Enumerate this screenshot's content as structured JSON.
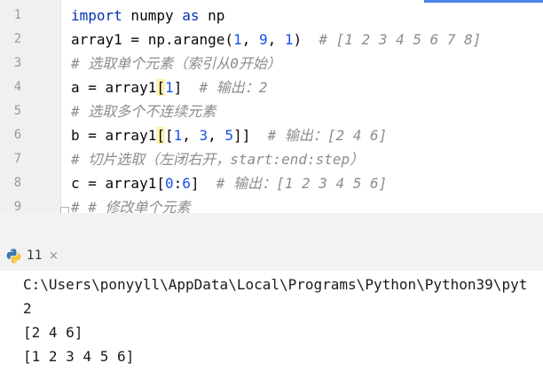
{
  "editor": {
    "line_numbers": [
      "1",
      "2",
      "3",
      "4",
      "5",
      "6",
      "7",
      "8",
      "9"
    ],
    "lines": [
      {
        "segments": [
          [
            "kw",
            "import"
          ],
          [
            "t",
            " numpy "
          ],
          [
            "kw",
            "as"
          ],
          [
            "t",
            " np"
          ]
        ]
      },
      {
        "segments": [
          [
            "t",
            "array1 = np.arange("
          ],
          [
            "num",
            "1"
          ],
          [
            "t",
            ", "
          ],
          [
            "num",
            "9"
          ],
          [
            "t",
            ", "
          ],
          [
            "num",
            "1"
          ],
          [
            "t",
            ")  "
          ],
          [
            "cm",
            "# [1 2 3 4 5 6 7 8]"
          ]
        ]
      },
      {
        "segments": [
          [
            "cm",
            "# 选取单个元素（索引从0开始）"
          ]
        ]
      },
      {
        "segments": [
          [
            "t",
            "a = array1"
          ],
          [
            "brk",
            "["
          ],
          [
            "num",
            "1"
          ],
          [
            "t",
            "]  "
          ],
          [
            "cm",
            "# 输出：2"
          ]
        ]
      },
      {
        "segments": [
          [
            "cm",
            "# 选取多个不连续元素"
          ]
        ]
      },
      {
        "segments": [
          [
            "t",
            "b = array1"
          ],
          [
            "brk",
            "["
          ],
          [
            "t",
            "["
          ],
          [
            "num",
            "1"
          ],
          [
            "t",
            ", "
          ],
          [
            "num",
            "3"
          ],
          [
            "t",
            ", "
          ],
          [
            "num",
            "5"
          ],
          [
            "t",
            "]]  "
          ],
          [
            "cm",
            "# 输出：[2 4 6]"
          ]
        ]
      },
      {
        "segments": [
          [
            "cm",
            "# 切片选取（左闭右开，start:end:step）"
          ]
        ]
      },
      {
        "segments": [
          [
            "t",
            "c = array1["
          ],
          [
            "num",
            "0"
          ],
          [
            "t",
            ":"
          ],
          [
            "num",
            "6"
          ],
          [
            "t",
            "]  "
          ],
          [
            "cm",
            "# 输出：[1 2 3 4 5 6]"
          ]
        ]
      },
      {
        "segments": [
          [
            "cm",
            "# # 修改单个元素"
          ]
        ]
      }
    ]
  },
  "run_panel": {
    "tab_label": "11",
    "close_glyph": "×",
    "icon": "python-icon"
  },
  "console": {
    "lines": [
      "C:\\Users\\ponyyll\\AppData\\Local\\Programs\\Python\\Python39\\pyt",
      "2",
      "[2 4 6]",
      "[1 2 3 4 5 6]"
    ]
  }
}
